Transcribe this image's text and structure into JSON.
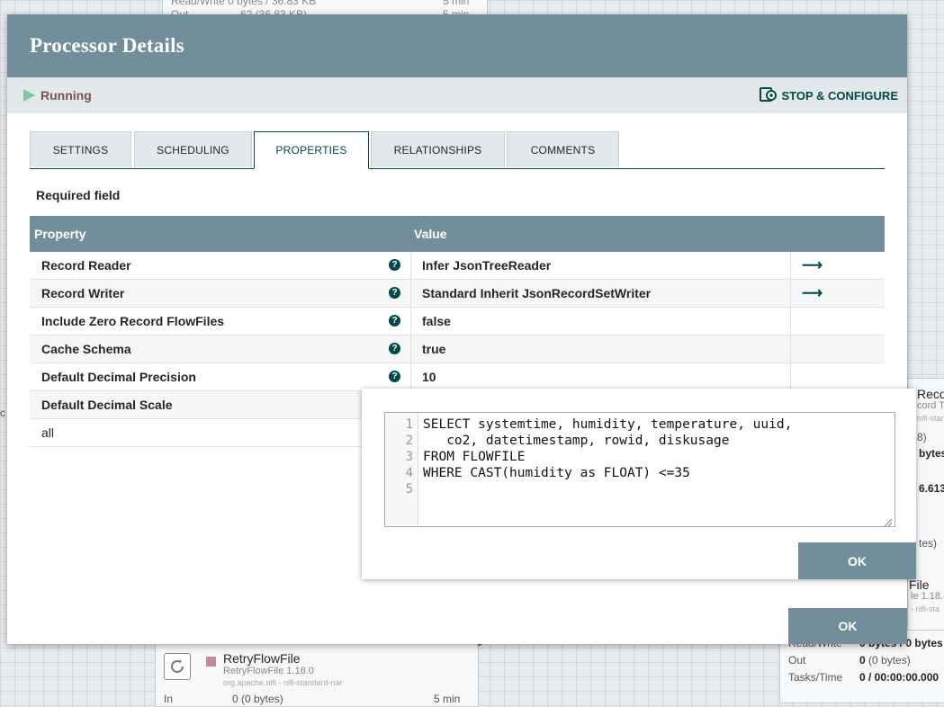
{
  "background": {
    "top_card_row1": "Read/Write    0 bytes / 36.83 KB",
    "top_card_row1_time": "5 min",
    "top_card_out_label": "Out",
    "top_card_out_value": "62 (36.83 KB)",
    "top_card_out_time": "5 min",
    "right_card_title": "Reco",
    "right_card_sub": "cord T",
    "right_card_bundle": "nifi-stand",
    "right_card_frag1": "8)",
    "right_card_frag2": "bytes",
    "right_card_frag3": "6.613",
    "right_card_frag4": "tes)",
    "right_card_file": "File",
    "right_card_ver": "le 1.18.(",
    "right_card_nar": "- nifi-sta",
    "stats_readwrite_label": "Read/Write",
    "stats_readwrite_value": "0 bytes / 0 bytes",
    "stats_out_label": "Out",
    "stats_out_value": "0",
    "stats_out_extra": "(0 bytes)",
    "stats_tasks_label": "Tasks/Time",
    "stats_tasks_value": "0 / 00:00:00.000",
    "retry_name": "RetryFlowFile",
    "retry_type": "RetryFlowFile 1.18.0",
    "retry_bundle": "org.apache.nifi - nifi-standard-nar",
    "retry_in_label": "In",
    "retry_in_value": "0 (0 bytes)",
    "retry_in_time": "5 min",
    "left_frag": "c"
  },
  "dialog": {
    "title": "Processor Details",
    "status": "Running",
    "stop_configure": "STOP & CONFIGURE",
    "tabs": [
      "SETTINGS",
      "SCHEDULING",
      "PROPERTIES",
      "RELATIONSHIPS",
      "COMMENTS"
    ],
    "active_tab": "PROPERTIES",
    "required_field": "Required field",
    "table": {
      "col_property": "Property",
      "col_value": "Value",
      "rows": [
        {
          "name": "Record Reader",
          "value": "Infer JsonTreeReader"
        },
        {
          "name": "Record Writer",
          "value": "Standard Inherit JsonRecordSetWriter"
        },
        {
          "name": "Include Zero Record FlowFiles",
          "value": "false"
        },
        {
          "name": "Cache Schema",
          "value": "true"
        },
        {
          "name": "Default Decimal Precision",
          "value": "10"
        },
        {
          "name": "Default Decimal Scale",
          "value": ""
        },
        {
          "name": "all",
          "value": ""
        }
      ]
    },
    "ok_label": "OK"
  },
  "editor": {
    "line_numbers": [
      "1",
      "2",
      "3",
      "4",
      "5"
    ],
    "lines": [
      "SELECT systemtime, humidity, temperature, uuid,",
      "   co2, datetimestamp, rowid, diskusage",
      "FROM FLOWFILE",
      "WHERE CAST(humidity as FLOAT) <=35",
      ""
    ],
    "ok_label": "OK"
  },
  "colors": {
    "header": "#728e9b",
    "status_bar": "#e3e8eb",
    "running": "#7dc7a0",
    "status_text": "#775351",
    "accent": "#004849"
  }
}
